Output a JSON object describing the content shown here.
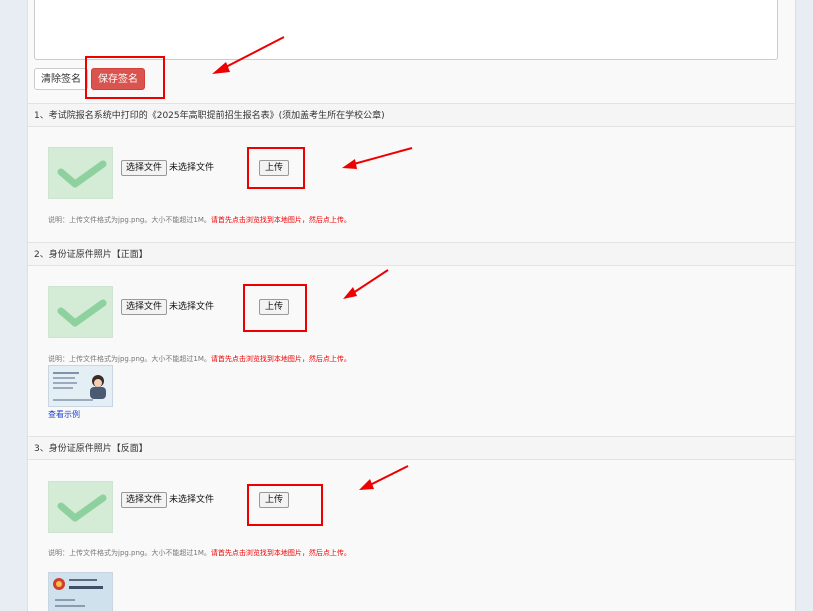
{
  "signature": {
    "clear_label": "清除签名",
    "save_label": "保存签名"
  },
  "upload_common": {
    "choose_label": "选择文件",
    "no_file_label": "未选择文件",
    "upload_label": "上传",
    "note_prefix": "说明：上传文件格式为jpg.png。大小不能超过1M。",
    "note_red": "请首先点击浏览找到本地图片，然后点上传。"
  },
  "sections": [
    {
      "title": "1、考试院报名系统中打印的《2025年高职提前招生报名表》(须加盖考生所在学校公章)"
    },
    {
      "title": "2、身份证原件照片【正面】",
      "sample_link": "查看示例"
    },
    {
      "title": "3、身份证原件照片【反面】"
    }
  ],
  "colors": {
    "save_button": "#d9534f",
    "highlight": "#ee0000",
    "link": "#1a3fd0",
    "thumb_bg": "#d4ebd6",
    "check": "#8fd19e"
  }
}
